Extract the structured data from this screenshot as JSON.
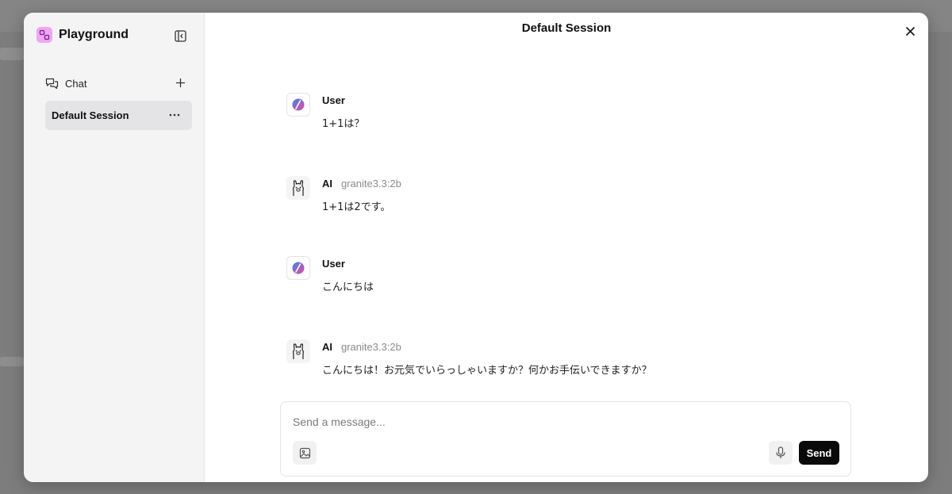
{
  "sidebar": {
    "brand_title": "Playground",
    "chat_label": "Chat",
    "sessions": [
      {
        "label": "Default Session",
        "selected": true
      }
    ]
  },
  "main": {
    "title": "Default Session",
    "messages": [
      {
        "role": "User",
        "model": "",
        "text": "1+1は？",
        "avatar": "user-orb-icon"
      },
      {
        "role": "AI",
        "model": "granite3.3:2b",
        "text": "1+1は2です。",
        "avatar": "llama-icon"
      },
      {
        "role": "User",
        "model": "",
        "text": "こんにちは",
        "avatar": "user-orb-icon"
      },
      {
        "role": "AI",
        "model": "granite3.3:2b",
        "text": "こんにちは！お元気でいらっしゃいますか？何かお手伝いできますか？",
        "avatar": "llama-icon"
      }
    ]
  },
  "composer": {
    "placeholder": "Send a message...",
    "value": "",
    "send_label": "Send"
  },
  "colors": {
    "brand_logo": "#f0a5f5",
    "send_button": "#0a0a0a",
    "overlay": "#7d7d7d"
  }
}
